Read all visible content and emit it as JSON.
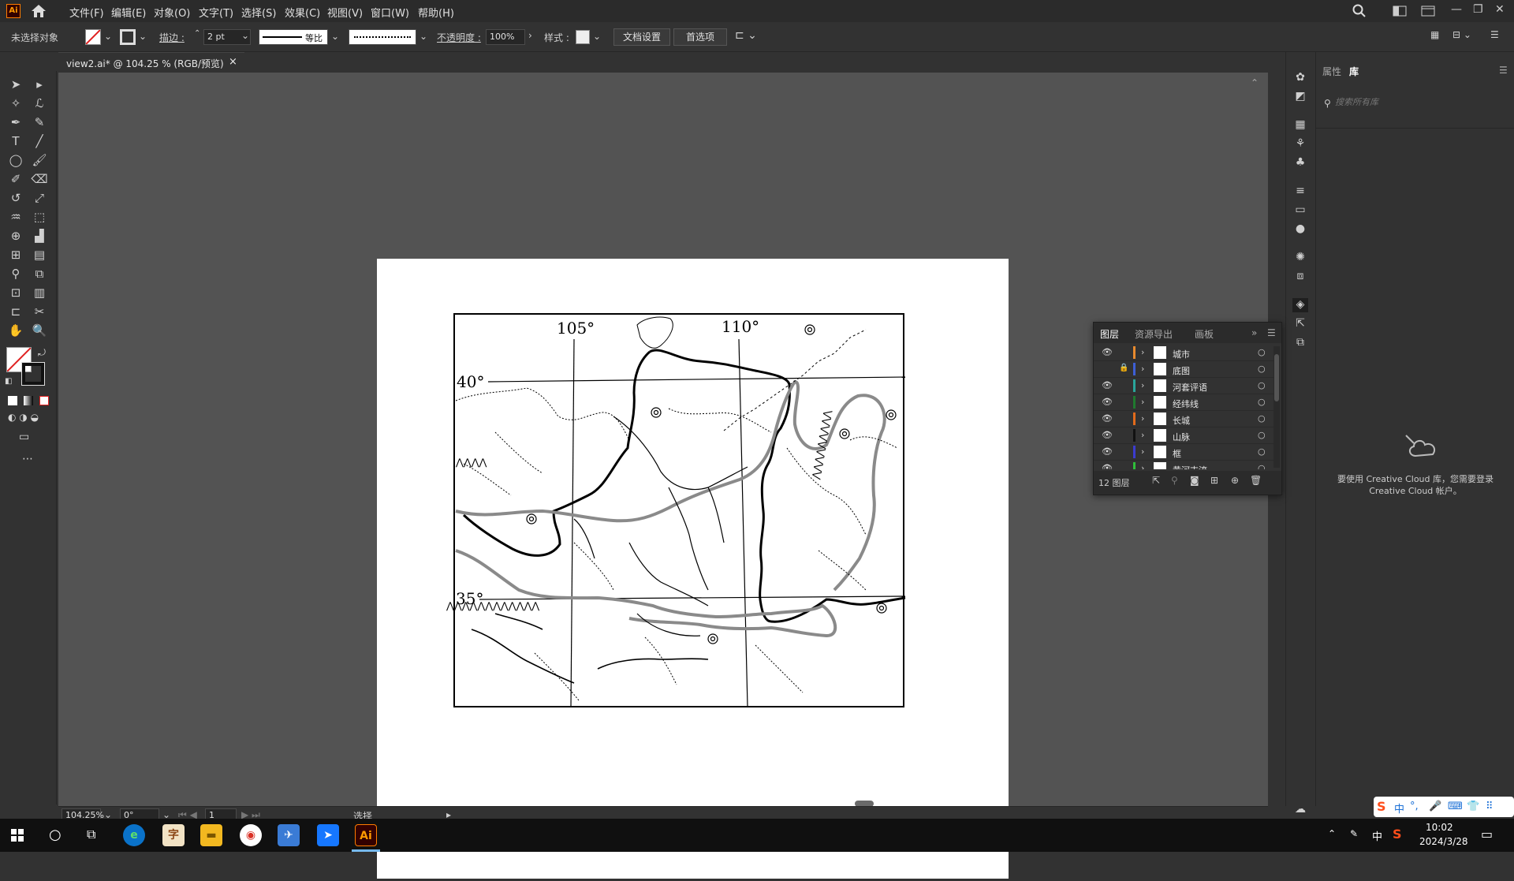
{
  "menubar": {
    "logo": "Ai",
    "items": [
      "文件(F)",
      "编辑(E)",
      "对象(O)",
      "文字(T)",
      "选择(S)",
      "效果(C)",
      "视图(V)",
      "窗口(W)",
      "帮助(H)"
    ]
  },
  "control": {
    "selection_status": "未选择对象",
    "stroke_label": "描边 :",
    "stroke_value": "2 pt",
    "stroke_profile": "等比",
    "opacity_label": "不透明度 :",
    "opacity_value": "100%",
    "style_label": "样式 :",
    "doc_settings": "文档设置",
    "preferences": "首选项"
  },
  "document": {
    "tab_title": "view2.ai* @ 104.25 % (RGB/预览)",
    "close": "×"
  },
  "map": {
    "lon_105": "105°",
    "lon_110": "110°",
    "lat_40": "40°",
    "lat_35": "35°"
  },
  "library": {
    "tab_properties": "属性",
    "tab_library": "库",
    "search_placeholder": "搜索所有库",
    "message": "要使用 Creative Cloud 库，您需要登录 Creative Cloud 帐户。"
  },
  "layers": {
    "tabs": [
      "图层",
      "资源导出",
      "画板"
    ],
    "rows": [
      {
        "name": "城市",
        "color": "#e88a2e",
        "locked": false,
        "visible": true
      },
      {
        "name": "底图",
        "color": "#3d5fd6",
        "locked": true,
        "visible": false
      },
      {
        "name": "河套评语",
        "color": "#2aa59b",
        "locked": false,
        "visible": true
      },
      {
        "name": "经纬线",
        "color": "#1f7a2e",
        "locked": false,
        "visible": true
      },
      {
        "name": "长城",
        "color": "#e26b1c",
        "locked": false,
        "visible": true
      },
      {
        "name": "山脉",
        "color": "#111111",
        "locked": false,
        "visible": true
      },
      {
        "name": "框",
        "color": "#3b3bcf",
        "locked": false,
        "visible": true
      },
      {
        "name": "黄河支流",
        "color": "#2fbf3a",
        "locked": false,
        "visible": true
      }
    ],
    "count": "12 图层"
  },
  "status": {
    "zoom": "104.25%",
    "rotation": "0°",
    "artboard": "1",
    "tool": "选择"
  },
  "taskbar": {
    "time": "10:02",
    "date": "2024/3/28",
    "ime": "中",
    "ime_tray": [
      "中",
      "°,",
      "🎤",
      "⌨",
      "👕",
      "⠿"
    ]
  },
  "colors": {
    "bg_dark": "#323232",
    "canvas": "#535353",
    "accent_ai": "#ff9a00"
  }
}
